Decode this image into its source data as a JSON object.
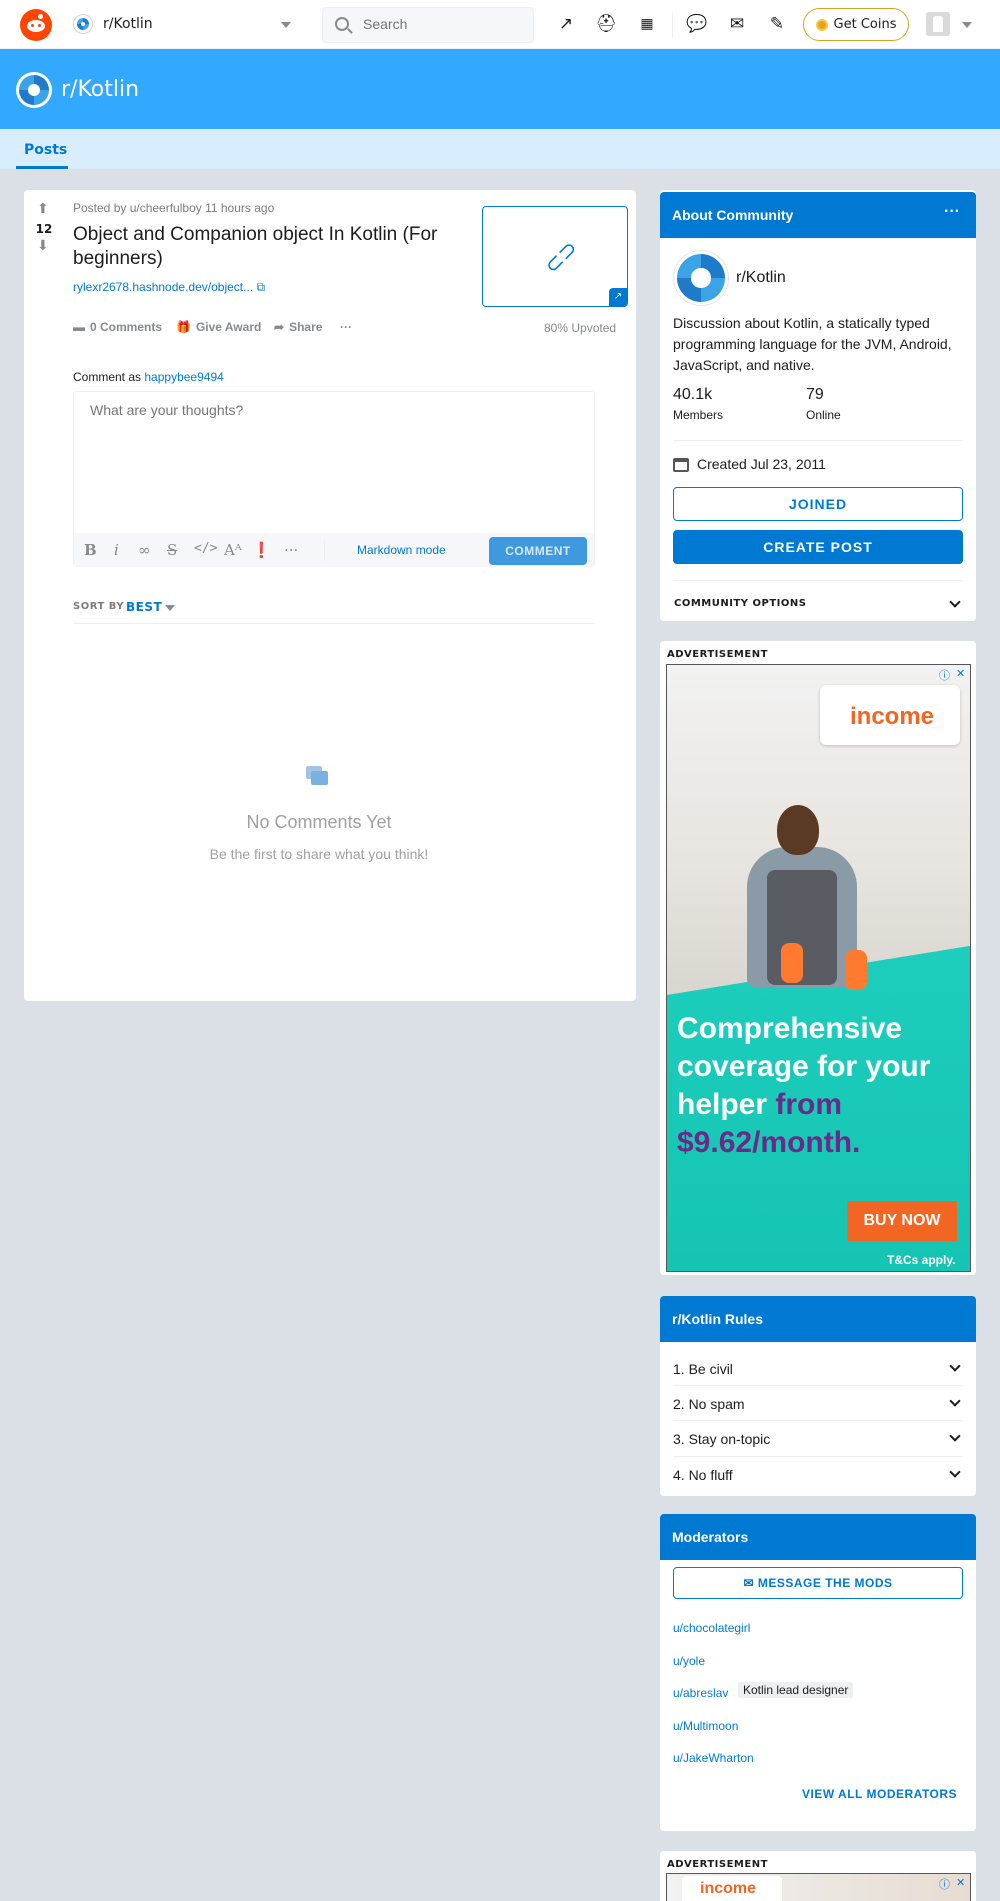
{
  "header": {
    "community": "r/Kotlin",
    "search_placeholder": "Search",
    "coins_label": "Get Coins"
  },
  "banner": {
    "title": "r/Kotlin"
  },
  "tabs": [
    {
      "label": "Posts"
    }
  ],
  "post": {
    "score": "12",
    "meta": "Posted by u/cheerfulboy 11 hours ago",
    "title": "Object and Companion object In Kotlin (For beginners)",
    "link": "rylexr2678.hashnode.dev/object...",
    "actions": {
      "comments": "0 Comments",
      "award": "Give Award",
      "share": "Share",
      "more": "···"
    },
    "upvoted": "80% Upvoted"
  },
  "comment": {
    "as_prefix": "Comment as",
    "username": "happybee9494",
    "placeholder": "What are your thoughts?",
    "markdown_mode": "Markdown mode",
    "submit": "COMMENT"
  },
  "sort": {
    "label": "SORT BY",
    "value": "BEST"
  },
  "empty": {
    "title": "No Comments Yet",
    "subtitle": "Be the first to share what you think!"
  },
  "about": {
    "header": "About Community",
    "name": "r/Kotlin",
    "description": "Discussion about Kotlin, a statically typed programming language for the JVM, Android, JavaScript, and native.",
    "members_count": "40.1k",
    "members_label": "Members",
    "online_count": "79",
    "online_label": "Online",
    "created": "Created Jul 23, 2011",
    "joined": "JOINED",
    "create_post": "CREATE POST",
    "options": "COMMUNITY OPTIONS"
  },
  "ad": {
    "label": "ADVERTISEMENT",
    "brand": "income",
    "headline_a": "Comprehensive coverage for your helper",
    "headline_b": "from $9.62/month.",
    "cta": "BUY NOW",
    "terms": "T&Cs apply."
  },
  "rules": {
    "header": "r/Kotlin Rules",
    "items": [
      "1. Be civil",
      "2. No spam",
      "3. Stay on-topic",
      "4. No fluff"
    ]
  },
  "mods": {
    "header": "Moderators",
    "message": "MESSAGE THE MODS",
    "list": [
      "u/chocolategirl",
      "u/yole",
      "u/abreslav",
      "u/Multimoon",
      "u/JakeWharton"
    ],
    "flair": "Kotlin lead designer",
    "view_all": "VIEW ALL MODERATORS"
  },
  "ad2": {
    "label": "ADVERTISEMENT",
    "brand": "income"
  },
  "colors": {
    "brand": "#ff4500",
    "banner": "#33a8ff",
    "accent": "#0079d3",
    "page_bg": "#dae0e6"
  }
}
